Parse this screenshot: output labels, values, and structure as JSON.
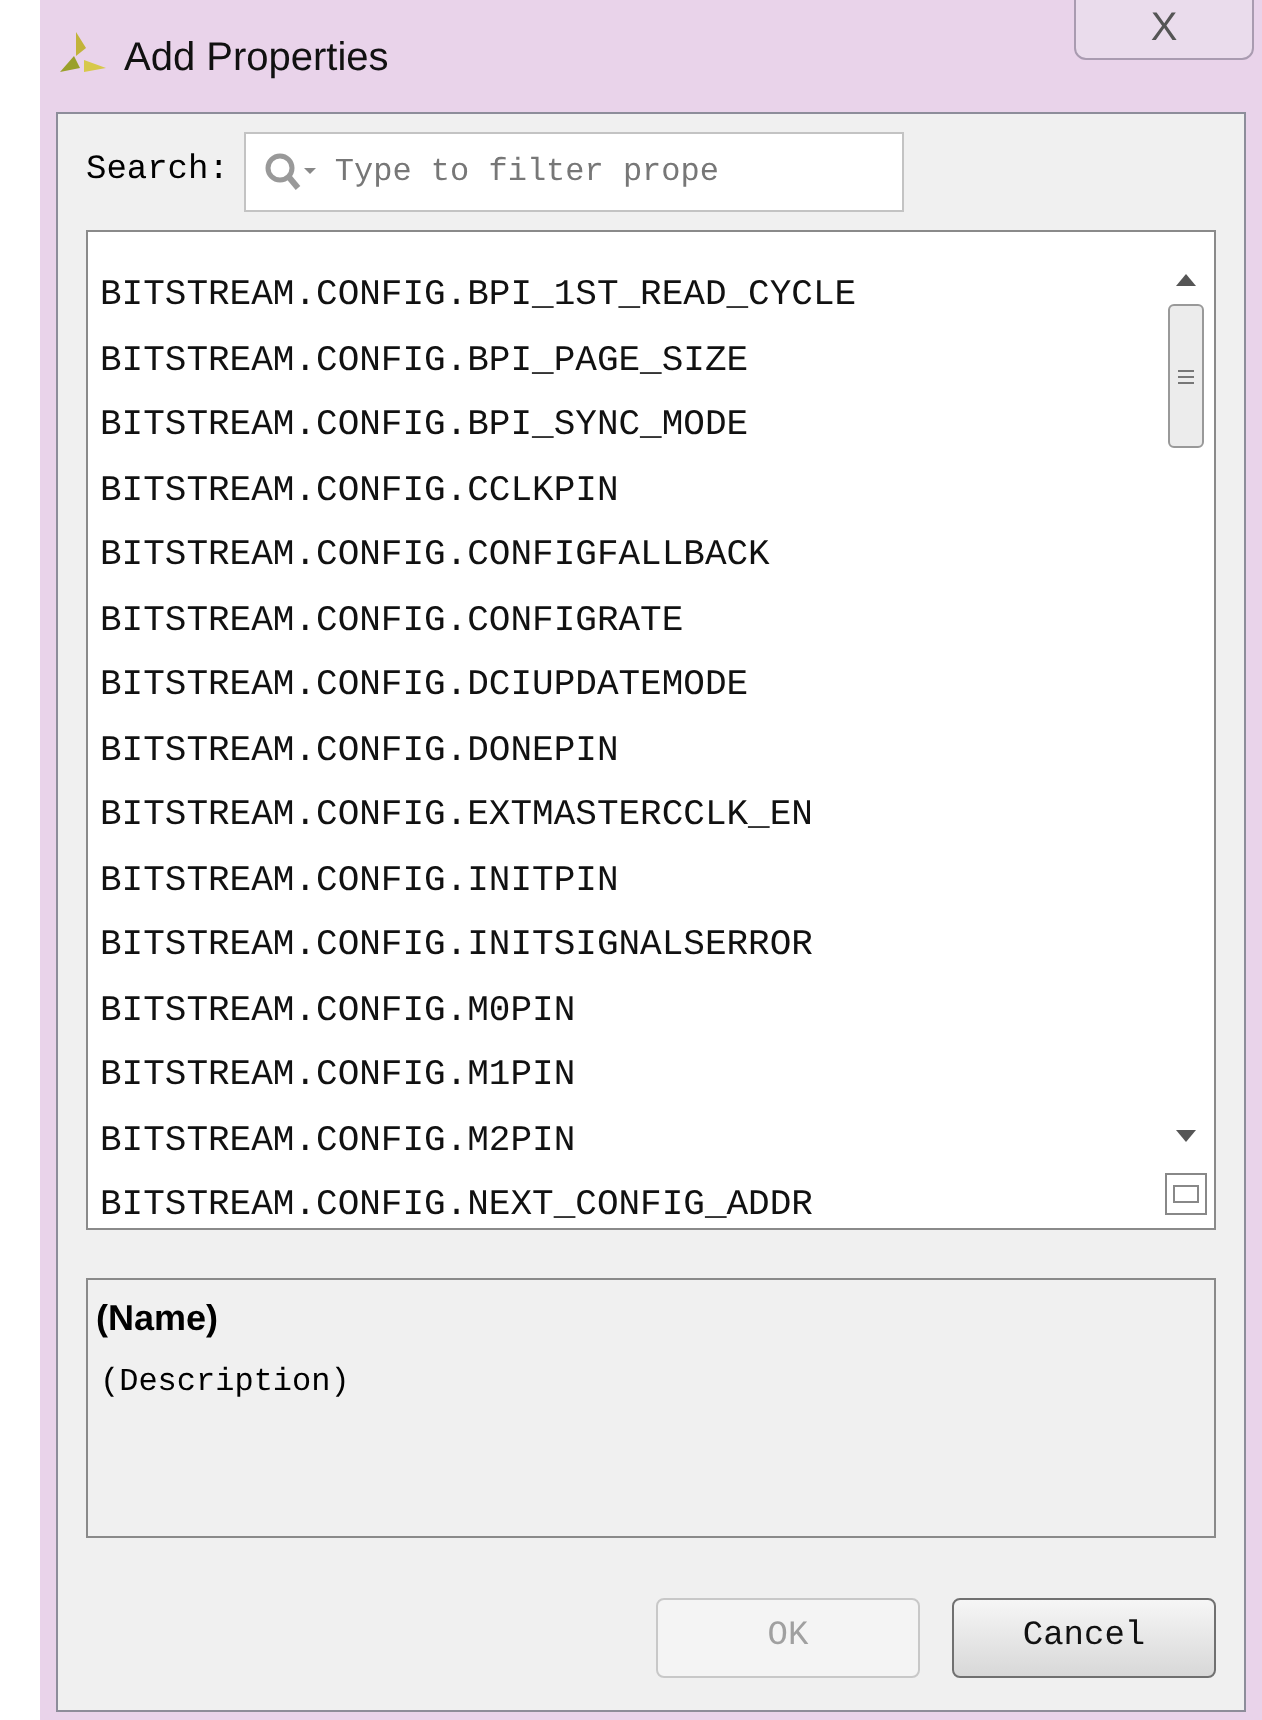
{
  "window": {
    "title": "Add Properties",
    "close": "X"
  },
  "search": {
    "label": "Search:",
    "placeholder": "Type to filter prope"
  },
  "properties": [
    "BITSTREAM.CONFIG.BPI_1ST_READ_CYCLE",
    "BITSTREAM.CONFIG.BPI_PAGE_SIZE",
    "BITSTREAM.CONFIG.BPI_SYNC_MODE",
    "BITSTREAM.CONFIG.CCLKPIN",
    "BITSTREAM.CONFIG.CONFIGFALLBACK",
    "BITSTREAM.CONFIG.CONFIGRATE",
    "BITSTREAM.CONFIG.DCIUPDATEMODE",
    "BITSTREAM.CONFIG.DONEPIN",
    "BITSTREAM.CONFIG.EXTMASTERCCLK_EN",
    "BITSTREAM.CONFIG.INITPIN",
    "BITSTREAM.CONFIG.INITSIGNALSERROR",
    "BITSTREAM.CONFIG.M0PIN",
    "BITSTREAM.CONFIG.M1PIN",
    "BITSTREAM.CONFIG.M2PIN",
    "BITSTREAM.CONFIG.NEXT_CONFIG_ADDR"
  ],
  "details": {
    "name": "(Name)",
    "description": "(Description)"
  },
  "buttons": [
    {
      "label": "OK",
      "disabled": true
    },
    {
      "label": "Cancel",
      "disabled": false
    }
  ]
}
